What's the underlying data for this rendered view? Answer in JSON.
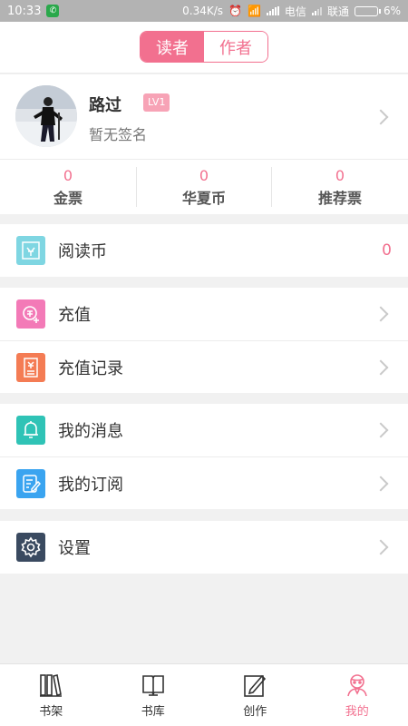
{
  "status_bar": {
    "time": "10:33",
    "speed": "0.34K/s",
    "carrier1": "电信",
    "carrier2": "联通",
    "battery": "6%"
  },
  "header": {
    "tabs": [
      {
        "label": "读者",
        "active": true
      },
      {
        "label": "作者",
        "active": false
      }
    ]
  },
  "profile": {
    "name": "路过",
    "level": "LV1",
    "signature": "暂无签名"
  },
  "stats": [
    {
      "value": "0",
      "label": "金票"
    },
    {
      "value": "0",
      "label": "华夏币"
    },
    {
      "value": "0",
      "label": "推荐票"
    }
  ],
  "menu": {
    "read_coin": {
      "label": "阅读币",
      "value": "0",
      "icon": "read-coin-icon",
      "color": "#7fd6e2"
    },
    "recharge": {
      "label": "充值",
      "icon": "coin-plus-icon",
      "color": "#f37ab7"
    },
    "recharge_records": {
      "label": "充值记录",
      "icon": "receipt-icon",
      "color": "#f47c54"
    },
    "messages": {
      "label": "我的消息",
      "icon": "bell-icon",
      "color": "#2fc3b6"
    },
    "subscriptions": {
      "label": "我的订阅",
      "icon": "edit-note-icon",
      "color": "#3aa4f0"
    },
    "settings": {
      "label": "设置",
      "icon": "gear-icon",
      "color": "#3a4a60"
    }
  },
  "tabbar": [
    {
      "label": "书架",
      "icon": "bookshelf-icon",
      "active": false
    },
    {
      "label": "书库",
      "icon": "open-book-icon",
      "active": false
    },
    {
      "label": "创作",
      "icon": "pen-paper-icon",
      "active": false
    },
    {
      "label": "我的",
      "icon": "user-profile-icon",
      "active": true
    }
  ],
  "colors": {
    "accent": "#f2708f"
  }
}
